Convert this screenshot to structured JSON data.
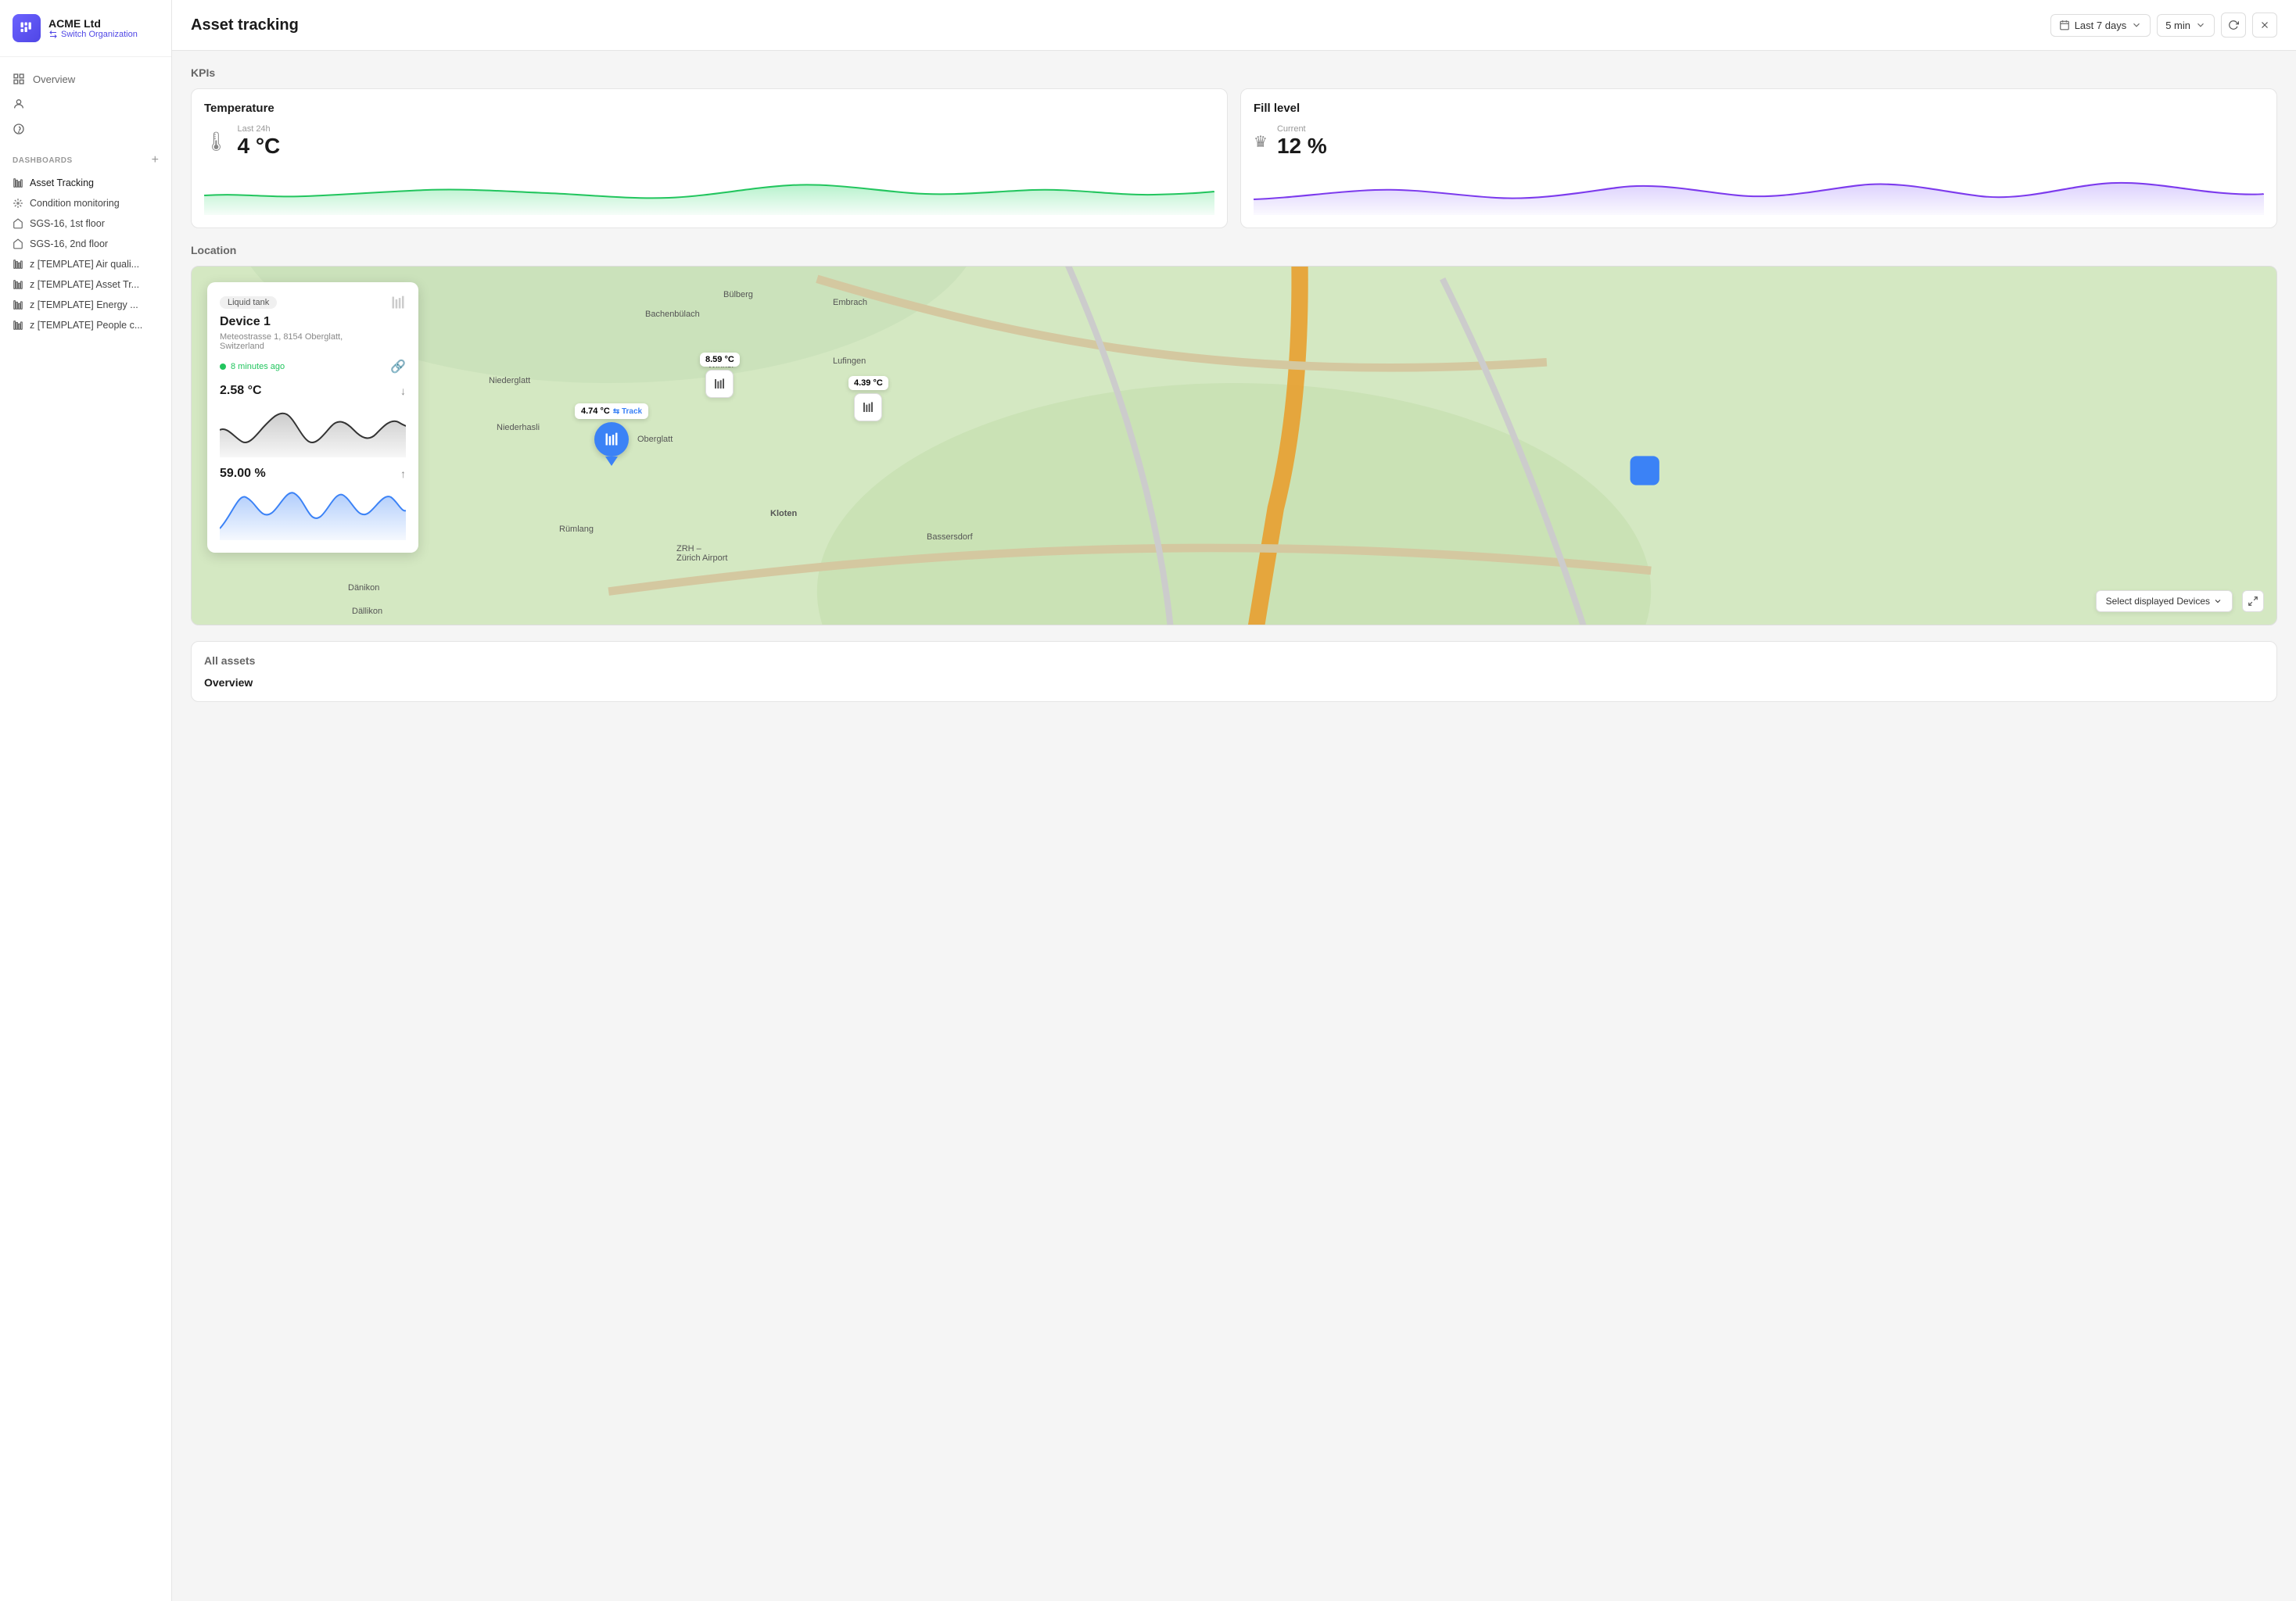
{
  "sidebar": {
    "org_name": "ACME Ltd",
    "switch_org": "Switch Organization",
    "nav": [
      {
        "id": "overview",
        "label": "Overview",
        "icon": "grid"
      },
      {
        "id": "users",
        "label": "",
        "icon": "user"
      },
      {
        "id": "help",
        "label": "",
        "icon": "help"
      }
    ],
    "dashboards_label": "DASHBOARDS",
    "add_label": "+",
    "dash_items": [
      {
        "id": "asset-tracking",
        "label": "Asset Tracking",
        "active": true
      },
      {
        "id": "condition-monitoring",
        "label": "Condition monitoring"
      },
      {
        "id": "sgs-1st",
        "label": "SGS-16, 1st floor"
      },
      {
        "id": "sgs-2nd",
        "label": "SGS-16, 2nd floor"
      },
      {
        "id": "air-quality",
        "label": "z [TEMPLATE] Air quali..."
      },
      {
        "id": "asset-tr",
        "label": "z [TEMPLATE] Asset Tr..."
      },
      {
        "id": "energy",
        "label": "z [TEMPLATE] Energy ..."
      },
      {
        "id": "people",
        "label": "z [TEMPLATE] People c..."
      }
    ]
  },
  "header": {
    "title": "Asset tracking",
    "time_range": "Last 7 days",
    "interval": "5 min"
  },
  "kpis": {
    "section_label": "KPIs",
    "temperature": {
      "title": "Temperature",
      "period": "Last 24h",
      "value": "4 °C",
      "icon": "thermometer"
    },
    "fill_level": {
      "title": "Fill level",
      "period": "Current",
      "value": "12 %",
      "icon": "bathtub"
    }
  },
  "location": {
    "section_label": "Location",
    "map_labels": [
      "Bülberg",
      "Bachenbülach",
      "Embrach",
      "Niederglatt",
      "Winkel",
      "Lufingen",
      "Niederhasli",
      "Oberglatt",
      "Rümlang",
      "Kloten",
      "Dänikon",
      "Dällikon",
      "ZRH – Zürich Airport",
      "Bassersdorf"
    ],
    "device_popup": {
      "tag": "Liquid tank",
      "name": "Device 1",
      "address": "Meteostrasse 1, 8154 Oberglatt, Switzerland",
      "status": "8 minutes ago",
      "temperature": "2.58 °C",
      "fill": "59.00 %"
    },
    "markers": [
      {
        "id": "main-marker",
        "temp": "4.74 °C",
        "track": "Track"
      },
      {
        "id": "marker-2",
        "temp": "8.59 °C"
      },
      {
        "id": "marker-3",
        "temp": "4.39 °C"
      }
    ],
    "select_devices": "Select displayed Devices"
  },
  "all_assets": {
    "section_label": "All assets",
    "overview_label": "Overview"
  }
}
